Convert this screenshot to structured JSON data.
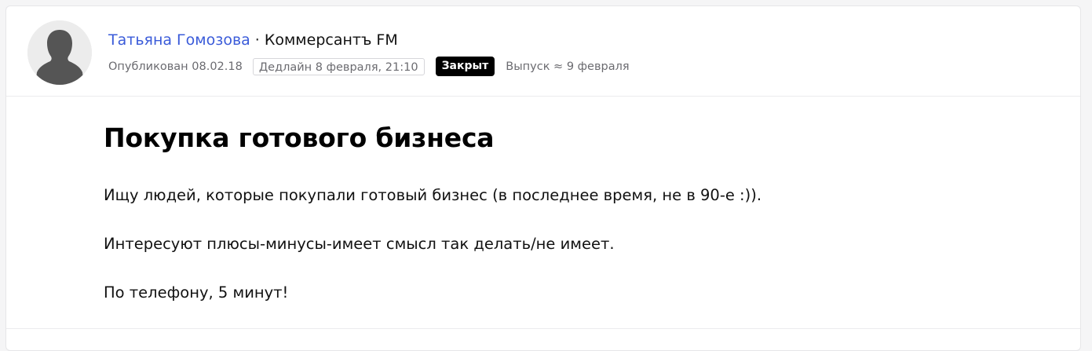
{
  "author": {
    "name": "Татьяна Гомозова",
    "separator": "·",
    "company": "Коммерсантъ FM"
  },
  "meta": {
    "published": "Опубликован 08.02.18",
    "deadline": "Дедлайн 8 февраля, 21:10",
    "status": "Закрыт",
    "release": "Выпуск ≈ 9 февраля"
  },
  "post": {
    "title": "Покупка готового бизнеса",
    "paragraphs": [
      "Ищу людей, которые покупали готовый бизнес (в последнее время, не в 90-е :)).",
      "Интересуют плюсы-минусы-имеет смысл так делать/не имеет.",
      "По телефону, 5 минут!"
    ]
  },
  "icons": {
    "avatar": "user-silhouette-icon"
  },
  "colors": {
    "author_link": "#3a5bd9",
    "status_badge_bg": "#000000",
    "status_badge_text": "#ffffff",
    "meta_text": "#6b6b70"
  }
}
